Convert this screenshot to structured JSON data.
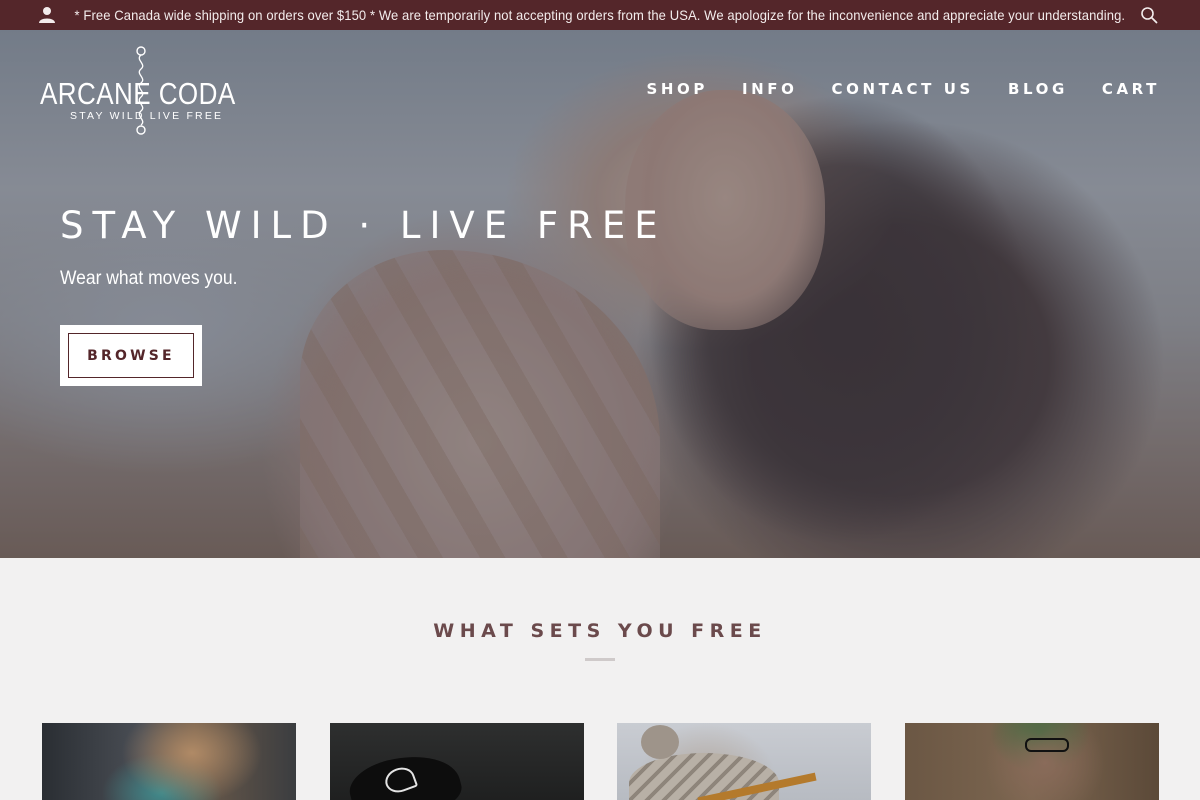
{
  "announcement": {
    "text": "* Free Canada wide shipping on orders over $150 * We are temporarily not accepting orders from the USA. We apologize for the inconvenience and appreciate your understanding.",
    "account_icon": "user-icon",
    "search_icon": "search-icon"
  },
  "header": {
    "logo_name": "ARCANE CODA",
    "logo_tagline": "STAY WILD LIVE FREE",
    "nav": [
      "SHOP",
      "INFO",
      "CONTACT US",
      "BLOG",
      "CART"
    ]
  },
  "hero": {
    "title": "STAY WILD · LIVE FREE",
    "subtitle": "Wear what moves you.",
    "button_label": "BROWSE"
  },
  "section": {
    "title": "WHAT SETS YOU FREE"
  },
  "colors": {
    "brand": "#54262a",
    "section_title": "#6b4a4c",
    "page_background": "#f2f1f1"
  }
}
